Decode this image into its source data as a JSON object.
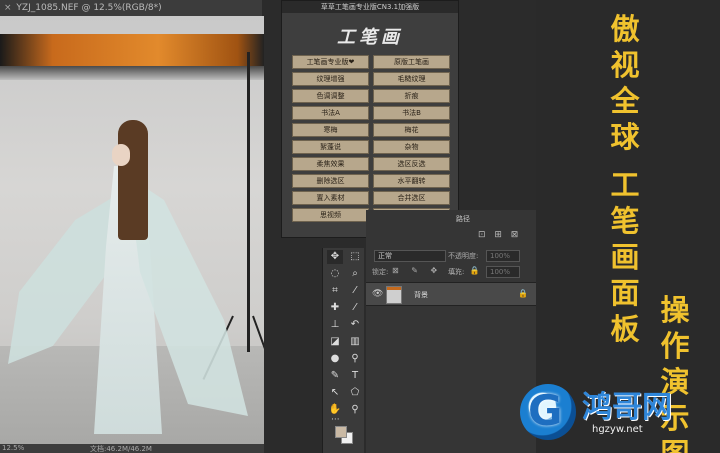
{
  "document": {
    "tab_title": "YZJ_1085.NEF @ 12.5%(RGB/8*)",
    "close_glyph": "×"
  },
  "status": {
    "zoom": "12.5%",
    "doc_info": "文档:46.2M/46.2M"
  },
  "plugin": {
    "title": "草草工笔画专业版CN3.1加强版",
    "logo": "工笔画",
    "buttons": [
      "工笔画专业版❤",
      "原版工笔画",
      "纹理增强",
      "毛糙纹理",
      "色调调整",
      "折痕",
      "书法A",
      "书法B",
      "寒梅",
      "梅花",
      "絮蓬说",
      "杂物",
      "柔焦效果",
      "选区反选",
      "删除选区",
      "水平翻转",
      "置入素材",
      "合并选区",
      "思视频",
      "草草PS论坛"
    ]
  },
  "tools": {
    "items": [
      {
        "name": "move-tool",
        "glyph": "✥",
        "active": true
      },
      {
        "name": "marquee-tool",
        "glyph": "⬚",
        "active": false
      },
      {
        "name": "lasso-tool",
        "glyph": "◌",
        "active": false
      },
      {
        "name": "quick-select-tool",
        "glyph": "⌕",
        "active": false
      },
      {
        "name": "crop-tool",
        "glyph": "⌗",
        "active": false
      },
      {
        "name": "eyedropper-tool",
        "glyph": "⁄",
        "active": false
      },
      {
        "name": "healing-brush-tool",
        "glyph": "✚",
        "active": false
      },
      {
        "name": "brush-tool",
        "glyph": "⁄",
        "active": false
      },
      {
        "name": "stamp-tool",
        "glyph": "⊥",
        "active": false
      },
      {
        "name": "history-brush-tool",
        "glyph": "↶",
        "active": false
      },
      {
        "name": "eraser-tool",
        "glyph": "◪",
        "active": false
      },
      {
        "name": "gradient-tool",
        "glyph": "▥",
        "active": false
      },
      {
        "name": "blur-tool",
        "glyph": "●",
        "active": false
      },
      {
        "name": "dodge-tool",
        "glyph": "⚲",
        "active": false
      },
      {
        "name": "pen-tool",
        "glyph": "✎",
        "active": false
      },
      {
        "name": "type-tool",
        "glyph": "T",
        "active": false
      },
      {
        "name": "path-select-tool",
        "glyph": "↖",
        "active": false
      },
      {
        "name": "shape-tool",
        "glyph": "⬠",
        "active": false
      },
      {
        "name": "hand-tool",
        "glyph": "✋",
        "active": false
      },
      {
        "name": "zoom-tool",
        "glyph": "⚲",
        "active": false
      }
    ],
    "more": "···"
  },
  "layers": {
    "panel_tab": "路径",
    "top_icons": "⊡ ⊞ ⊠",
    "blend_mode": "正常",
    "opacity_label": "不透明度:",
    "opacity_value": "100%",
    "lock_label": "锁定:",
    "lock_icons": "⊠ ✎ ✥ ⬚ 🔒",
    "fill_label": "填充:",
    "fill_value": "100%",
    "layer_name": "背景",
    "eye_glyph": "👁",
    "lock_glyph": "🔒"
  },
  "overlay": {
    "column1": [
      "傲",
      "视",
      "全",
      "球",
      "",
      "工",
      "笔",
      "画",
      "面",
      "板"
    ],
    "column2": [
      "操",
      "作",
      "演",
      "示",
      "图"
    ],
    "brand": "鸿哥网",
    "url": "hgzyw.net",
    "logo_letter": "G"
  },
  "colors": {
    "button_bg": "#b7a78c",
    "overlay_text": "#f0c22e",
    "brand_blue": "#2f86d9"
  }
}
